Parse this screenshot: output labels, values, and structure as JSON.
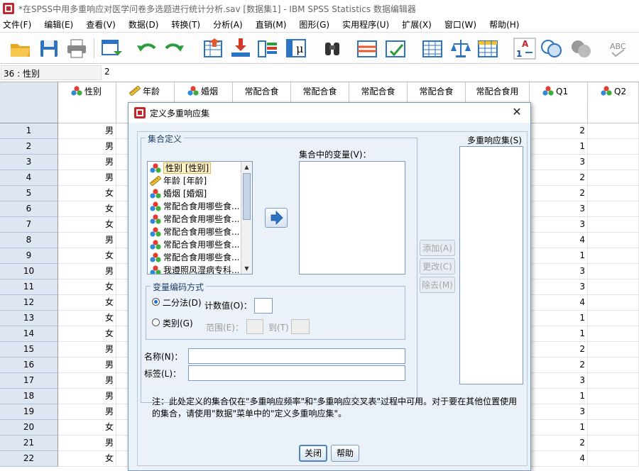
{
  "window": {
    "title": "*在SPSS中用多重响应对医学问卷多选题进行统计分析.sav [数据集1] - IBM SPSS Statistics 数据编辑器"
  },
  "menu": [
    "文件(F)",
    "编辑(E)",
    "查看(V)",
    "数据(D)",
    "转换(T)",
    "分析(A)",
    "直销(M)",
    "图形(G)",
    "实用程序(U)",
    "扩展(X)",
    "窗口(W)",
    "帮助(H)"
  ],
  "toolbar": [
    "open-icon",
    "save-icon",
    "print-icon",
    "dialog-recall-icon",
    "undo-icon",
    "redo-icon",
    "goto-case-icon",
    "goto-variable-icon",
    "variables-icon",
    "run-descriptives-icon",
    "find-icon",
    "insert-cases-icon",
    "insert-variable-icon",
    "split-file-icon",
    "weight-cases-icon",
    "select-cases-icon",
    "value-labels-icon",
    "use-sets-icon",
    "show-all-variables-icon",
    "spell-check-icon"
  ],
  "formula": {
    "cell_ref": "36 : 性别",
    "value": "2"
  },
  "grid": {
    "columns": [
      {
        "label": "性别",
        "icon": "nominal-icon"
      },
      {
        "label": "年龄",
        "icon": "scale-icon"
      },
      {
        "label": "婚烟",
        "icon": "nominal-icon"
      },
      {
        "label": "常配合食",
        "icon": ""
      },
      {
        "label": "常配合食",
        "icon": ""
      },
      {
        "label": "常配合食",
        "icon": ""
      },
      {
        "label": "常配合食",
        "icon": ""
      },
      {
        "label": "常配合食用",
        "icon": ""
      },
      {
        "label": "Q1",
        "icon": "nominal-icon"
      },
      {
        "label": "Q2",
        "icon": "nominal-icon"
      }
    ],
    "rows": [
      {
        "n": "1",
        "sex": "男",
        "q1": "2"
      },
      {
        "n": "2",
        "sex": "男",
        "q1": "1"
      },
      {
        "n": "3",
        "sex": "男",
        "q1": "3"
      },
      {
        "n": "4",
        "sex": "男",
        "q1": "2"
      },
      {
        "n": "5",
        "sex": "女",
        "q1": "2"
      },
      {
        "n": "6",
        "sex": "女",
        "q1": "3"
      },
      {
        "n": "7",
        "sex": "女",
        "q1": "3"
      },
      {
        "n": "8",
        "sex": "男",
        "q1": "4"
      },
      {
        "n": "9",
        "sex": "女",
        "q1": "1"
      },
      {
        "n": "10",
        "sex": "男",
        "q1": "3"
      },
      {
        "n": "11",
        "sex": "女",
        "q1": "3"
      },
      {
        "n": "12",
        "sex": "女",
        "q1": "4"
      },
      {
        "n": "13",
        "sex": "女",
        "q1": "1"
      },
      {
        "n": "14",
        "sex": "女",
        "q1": "1"
      },
      {
        "n": "15",
        "sex": "男",
        "q1": "2"
      },
      {
        "n": "16",
        "sex": "男",
        "q1": "2"
      },
      {
        "n": "17",
        "sex": "男",
        "q1": "3"
      },
      {
        "n": "18",
        "sex": "男",
        "q1": "1"
      },
      {
        "n": "19",
        "sex": "男",
        "q1": "3"
      },
      {
        "n": "20",
        "sex": "女",
        "q1": "1"
      },
      {
        "n": "21",
        "sex": "男",
        "q1": "2"
      },
      {
        "n": "22",
        "sex": "女",
        "q1": "4"
      }
    ]
  },
  "dialog": {
    "title": "定义多重响应集",
    "set_definition_label": "集合定义",
    "variables_in_set_label": "集合中的变量(V)：",
    "mr_sets_label": "多重响应集(S)",
    "source_list": [
      {
        "label": "性别 [性别]",
        "icon": "nominal-icon"
      },
      {
        "label": "年龄 [年龄]",
        "icon": "scale-icon"
      },
      {
        "label": "婚烟 [婚烟]",
        "icon": "nominal-icon"
      },
      {
        "label": "常配合食用哪些食...",
        "icon": "nominal-icon"
      },
      {
        "label": "常配合食用哪些食...",
        "icon": "nominal-icon"
      },
      {
        "label": "常配合食用哪些食...",
        "icon": "nominal-icon"
      },
      {
        "label": "常配合食用哪些食...",
        "icon": "nominal-icon"
      },
      {
        "label": "常配合食用哪些食...",
        "icon": "nominal-icon"
      },
      {
        "label": "我遵照风湿病专科...",
        "icon": "nominal-icon"
      }
    ],
    "encoding_label": "变量编码方式",
    "dichotomy_label": "二分法(D)",
    "count_value_label": "计数值(O)：",
    "category_label": "类别(G)",
    "range_label": "范围(E)：",
    "to_label": "到(T)",
    "name_label": "名称(N)：",
    "label_label": "标签(L)：",
    "add_label": "添加(A)",
    "change_label": "更改(C)",
    "remove_label": "除去(M)",
    "note_line1": "注：此处定义的集合仅在\"多重响应频率\"和\"多重响应交叉表\"过程中可用。对于要在其他位置使用",
    "note_line2": "的集合，请使用\"数据\"菜单中的\"定义多重响应集\"。",
    "close_label": "关闭",
    "help_label": "帮助"
  }
}
